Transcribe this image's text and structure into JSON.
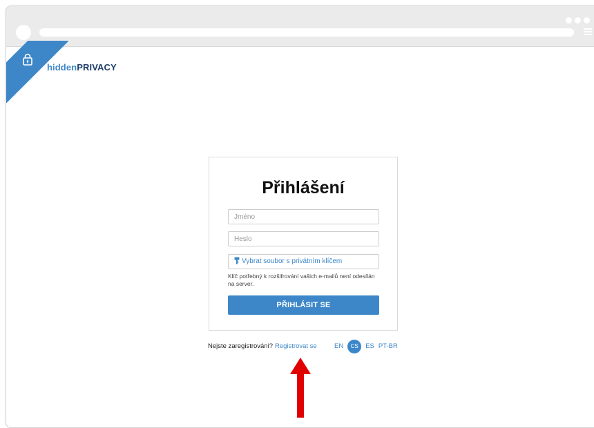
{
  "brand": {
    "part1": "hidden",
    "part2": "PRIVACY"
  },
  "login": {
    "title": "Přihlášení",
    "username_placeholder": "Jméno",
    "password_placeholder": "Heslo",
    "select_key_label": "Vybrat soubor s privátním klíčem",
    "key_hint": "Klíč potřebný k rozšifrování vašich e-mailů není odesílán na server.",
    "submit_label": "PŘIHLÁSIT SE"
  },
  "footer": {
    "not_registered": "Nejste zaregistrováni?",
    "register_link": "Registrovat se"
  },
  "languages": [
    {
      "code": "EN",
      "active": false
    },
    {
      "code": "CS",
      "active": true
    },
    {
      "code": "ES",
      "active": false
    },
    {
      "code": "PT-BR",
      "active": false
    }
  ],
  "icons": {
    "lock": "lock-icon",
    "key": "key-icon",
    "arrow": "arrow-up-icon"
  },
  "colors": {
    "accent": "#3d87c9",
    "brand_dark": "#1f3f69",
    "annotation_red": "#e00000"
  }
}
